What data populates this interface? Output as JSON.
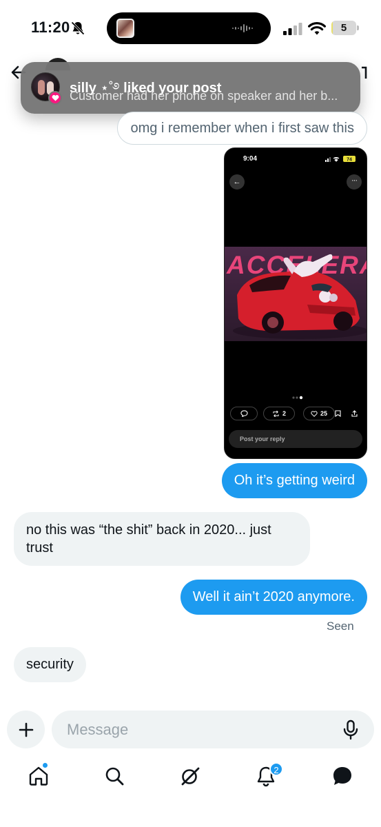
{
  "status_bar": {
    "time": "11:20",
    "battery": "5",
    "battery_level": 0.05
  },
  "notification": {
    "name": "silly",
    "name_suffix": " ⋆˚࿔",
    "action": " liked your post",
    "body": "Customer had her phone on speaker and her b..."
  },
  "messages": {
    "m1": "omg i remember when i first saw this",
    "m2": "Oh it’s getting weird",
    "m3": "no this was “the shit” back in 2020... just trust",
    "m4": "Well it ain’t 2020 anymore.",
    "seen": "Seen",
    "m5": "security"
  },
  "embedded_post": {
    "time": "9:04",
    "battery": "74",
    "image_text": "ACCELERATE",
    "retweets": "2",
    "likes": "25",
    "reply_placeholder": "Post your reply"
  },
  "composer": {
    "placeholder": "Message"
  },
  "nav": {
    "notifications_badge": "2"
  },
  "colors": {
    "accent": "#1d9bf0",
    "like_pink": "#f91880",
    "incoming_bubble": "#eff3f4"
  }
}
